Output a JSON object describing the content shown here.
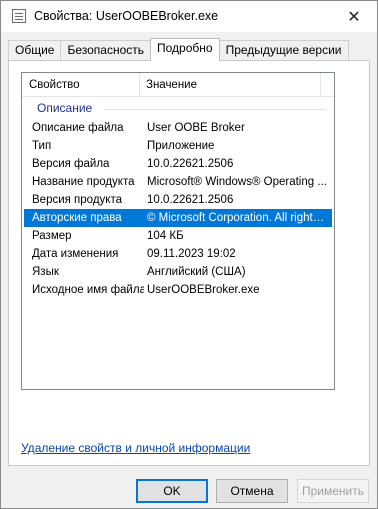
{
  "window": {
    "title": "Свойства: UserOOBEBroker.exe",
    "close_glyph": "✕"
  },
  "tabs": [
    {
      "label": "Общие",
      "active": false
    },
    {
      "label": "Безопасность",
      "active": false
    },
    {
      "label": "Подробно",
      "active": true
    },
    {
      "label": "Предыдущие версии",
      "active": false
    }
  ],
  "details": {
    "columns": {
      "property": "Свойство",
      "value": "Значение"
    },
    "group": "Описание",
    "rows": [
      {
        "property": "Описание файла",
        "value": "User OOBE Broker"
      },
      {
        "property": "Тип",
        "value": "Приложение"
      },
      {
        "property": "Версия файла",
        "value": "10.0.22621.2506"
      },
      {
        "property": "Название продукта",
        "value": "Microsoft® Windows® Operating ..."
      },
      {
        "property": "Версия продукта",
        "value": "10.0.22621.2506"
      },
      {
        "property": "Авторские права",
        "value": "© Microsoft Corporation. All rights ..."
      },
      {
        "property": "Размер",
        "value": "104 КБ"
      },
      {
        "property": "Дата изменения",
        "value": "09.11.2023 19:02"
      },
      {
        "property": "Язык",
        "value": "Английский (США)"
      },
      {
        "property": "Исходное имя файла",
        "value": "UserOOBEBroker.exe"
      }
    ],
    "selected_row_index": 5
  },
  "remove_link": "Удаление свойств и личной информации",
  "buttons": {
    "ok": "OK",
    "cancel": "Отмена",
    "apply": "Применить"
  },
  "colors": {
    "selection": "#0078d7",
    "group_label": "#1e3287",
    "link": "#0645ad"
  }
}
